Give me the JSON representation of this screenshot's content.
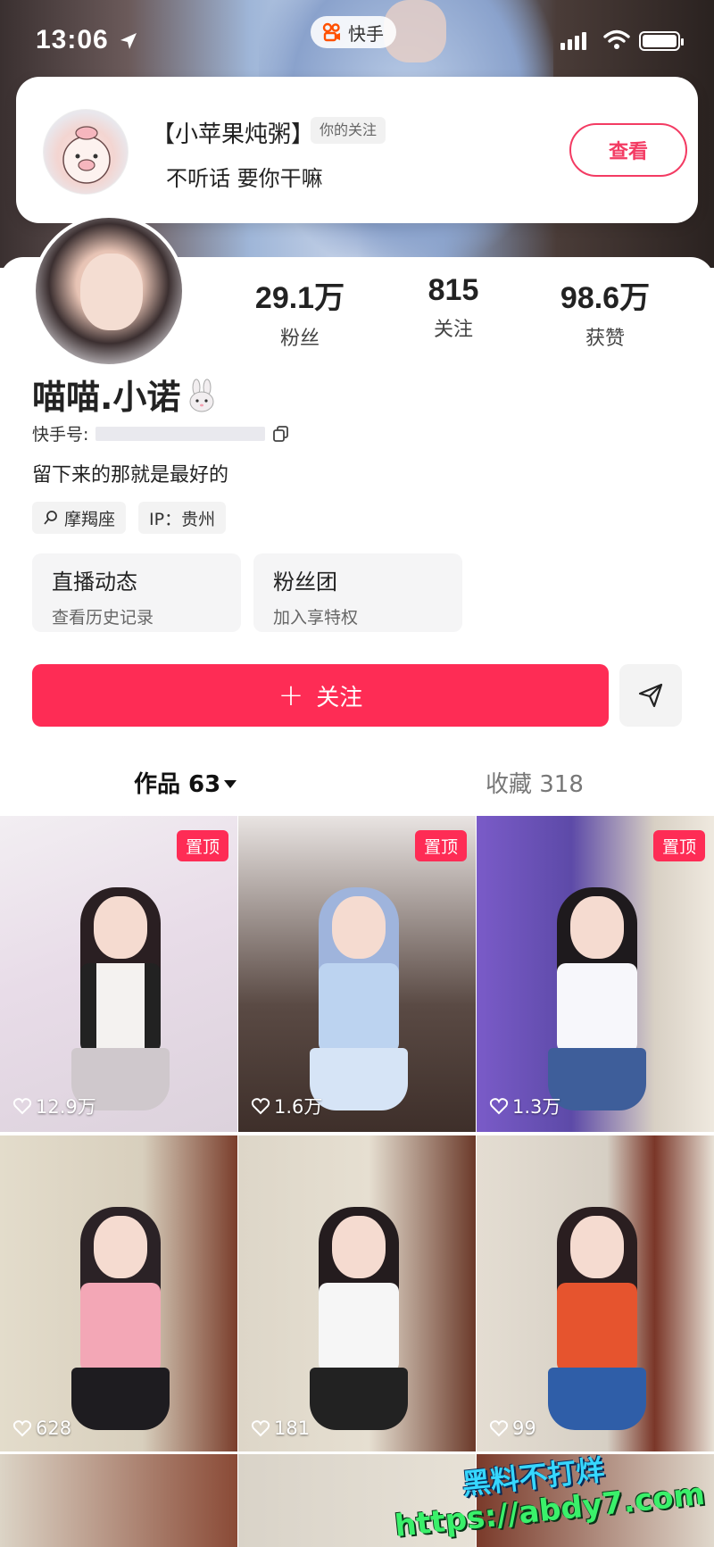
{
  "status_bar": {
    "time": "13:06",
    "app_name": "快手"
  },
  "notification": {
    "name": "【小苹果炖粥】",
    "tag": "你的关注",
    "message": "不听话 要你干嘛",
    "button_label": "查看"
  },
  "profile": {
    "stats": [
      {
        "value": "29.1万",
        "label": "粉丝"
      },
      {
        "value": "815",
        "label": "关注"
      },
      {
        "value": "98.6万",
        "label": "获赞"
      }
    ],
    "username": "喵喵.小诺",
    "kuaishou_id_label": "快手号:",
    "bio": "留下来的那就是最好的",
    "chips": [
      "摩羯座",
      "IP：贵州"
    ],
    "cards": [
      {
        "title": "直播动态",
        "subtitle": "查看历史记录"
      },
      {
        "title": "粉丝团",
        "subtitle": "加入享特权"
      }
    ],
    "follow_label": "关注",
    "follow_plus": "+"
  },
  "tabs": {
    "works_label": "作品 63",
    "favorites_label": "收藏 318"
  },
  "grid": {
    "pin_label": "置顶",
    "items": [
      {
        "likes": "12.9万",
        "pinned": true
      },
      {
        "likes": "1.6万",
        "pinned": true
      },
      {
        "likes": "1.3万",
        "pinned": true
      },
      {
        "likes": "628",
        "pinned": false
      },
      {
        "likes": "181",
        "pinned": false
      },
      {
        "likes": "99",
        "pinned": false
      }
    ]
  },
  "watermark": {
    "line1": "黑料不打烊",
    "line2": "https://abdy7.com"
  },
  "colors": {
    "accent": "#fe2c55",
    "view_button": "#f33b63"
  }
}
